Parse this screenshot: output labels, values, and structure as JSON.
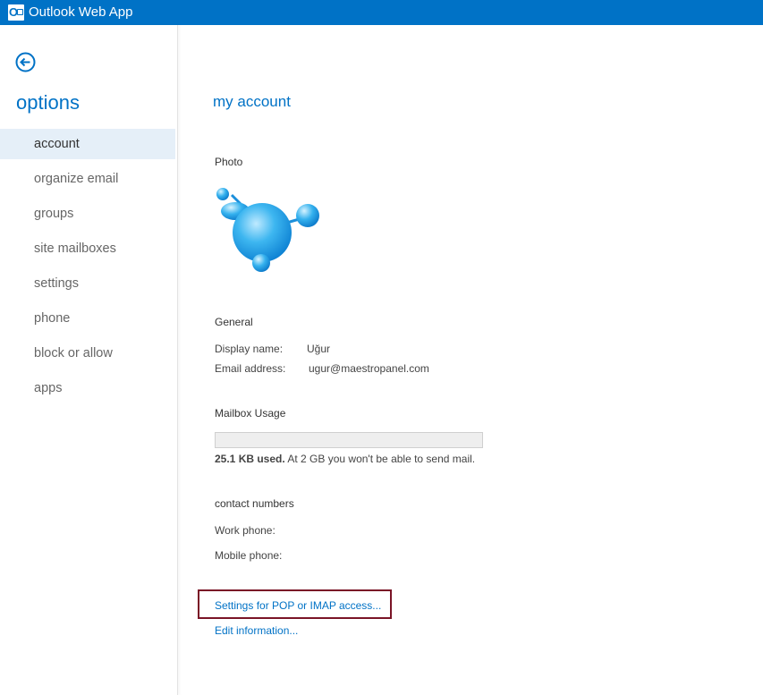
{
  "header": {
    "app_title": "Outlook Web App",
    "logo_icon": "outlook-logo-icon",
    "color": "#0072c6"
  },
  "navigation": {
    "back_icon": "back-arrow-icon"
  },
  "sidebar": {
    "title": "options",
    "items": [
      {
        "label": "account",
        "active": true
      },
      {
        "label": "organize email",
        "active": false
      },
      {
        "label": "groups",
        "active": false
      },
      {
        "label": "site mailboxes",
        "active": false
      },
      {
        "label": "settings",
        "active": false
      },
      {
        "label": "phone",
        "active": false
      },
      {
        "label": "block or allow",
        "active": false
      },
      {
        "label": "apps",
        "active": false
      }
    ]
  },
  "main": {
    "title": "my account",
    "photo": {
      "heading": "Photo",
      "image": "bubble-avatar-icon"
    },
    "general": {
      "heading": "General",
      "display_name_label": "Display name:",
      "display_name_value": "Uğur",
      "email_label": "Email address:",
      "email_value": "ugur@maestropanel.com"
    },
    "mailbox": {
      "heading": "Mailbox Usage",
      "used_fraction": 0.0,
      "used_text": "25.1 KB used.",
      "limit_text": " At 2 GB you won't be able to send mail."
    },
    "contact": {
      "heading": "contact numbers",
      "work_phone_label": "Work phone:",
      "mobile_phone_label": "Mobile phone:"
    },
    "links": {
      "pop_imap": "Settings for POP or IMAP access...",
      "edit_info": "Edit information..."
    }
  }
}
